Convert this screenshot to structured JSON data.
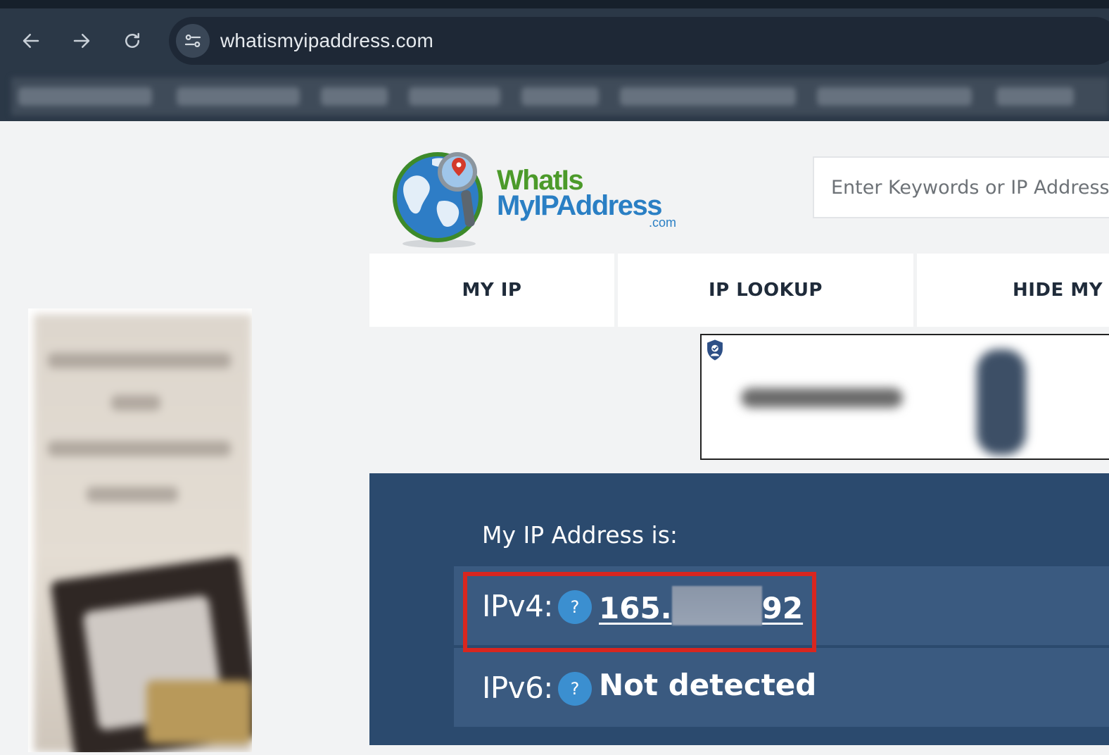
{
  "browser": {
    "url": "whatismyipaddress.com",
    "nav_icons": [
      "back-arrow-icon",
      "forward-arrow-icon",
      "reload-icon"
    ],
    "site_info_icon": "tune-icon"
  },
  "site": {
    "logo": {
      "line1": "WhatIs",
      "line2": "MyIPAddress",
      "line3": ".com"
    },
    "search": {
      "placeholder": "Enter Keywords or IP Address..."
    },
    "nav": {
      "tabs": [
        {
          "label": "MY IP"
        },
        {
          "label": "IP LOOKUP"
        },
        {
          "label": "HIDE MY I"
        }
      ]
    },
    "ip_panel": {
      "heading": "My IP Address is:",
      "ipv4": {
        "label": "IPv4:",
        "help": "?",
        "value_start": "165.",
        "value_end": "92"
      },
      "ipv6": {
        "label": "IPv6:",
        "help": "?",
        "value": "Not detected"
      }
    }
  },
  "colors": {
    "browser_chrome": "#2b3847",
    "page_bg": "#f2f3f4",
    "panel_bg": "#2b4a6e",
    "row_bg": "#3a5a80",
    "help_icon": "#3b8fd0",
    "highlight": "#d8261f",
    "logo_green": "#4c9a2a",
    "logo_blue": "#2a7fc4"
  }
}
